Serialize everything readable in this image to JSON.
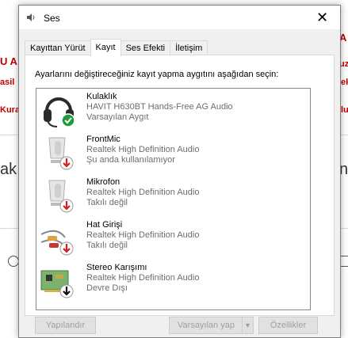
{
  "background": {
    "fragments": [
      "U A",
      "A",
      "uz,",
      "asil",
      "ek",
      "Kura",
      "lu",
      "ak",
      "n"
    ]
  },
  "window": {
    "title": "Ses",
    "close_glyph": "✕"
  },
  "tabs": [
    {
      "label": "Kayıttan Yürüt",
      "active": false
    },
    {
      "label": "Kayıt",
      "active": true
    },
    {
      "label": "Ses Efekti",
      "active": false
    },
    {
      "label": "İletişim",
      "active": false
    }
  ],
  "instruction": "Ayarlarını değiştireceğiniz kayıt yapma aygıtını aşağıdan seçin:",
  "devices": [
    {
      "name": "Kulaklık",
      "description": "HAVIT H630BT Hands-Free AG Audio",
      "status": "Varsayılan Aygıt",
      "icon": "headset-icon",
      "badge": "check-badge-icon"
    },
    {
      "name": "FrontMic",
      "description": "Realtek High Definition Audio",
      "status": "Şu anda kullanılamıyor",
      "icon": "microphone-icon",
      "badge": "down-arrow-red-badge-icon"
    },
    {
      "name": "Mikrofon",
      "description": "Realtek High Definition Audio",
      "status": "Takılı değil",
      "icon": "microphone-icon",
      "badge": "down-arrow-red-badge-icon"
    },
    {
      "name": "Hat Girişi",
      "description": "Realtek High Definition Audio",
      "status": "Takılı değil",
      "icon": "line-in-cable-icon",
      "badge": "down-arrow-red-badge-icon"
    },
    {
      "name": "Stereo Karışımı",
      "description": "Realtek High Definition Audio",
      "status": "Devre Dışı",
      "icon": "circuit-board-icon",
      "badge": "down-arrow-black-badge-icon"
    }
  ],
  "buttons": {
    "configure": "Yapılandır",
    "set_default": "Varsayılan yap",
    "properties": "Özellikler"
  },
  "colors": {
    "accent_check": "#1e9a36",
    "badge_red": "#d32020"
  }
}
